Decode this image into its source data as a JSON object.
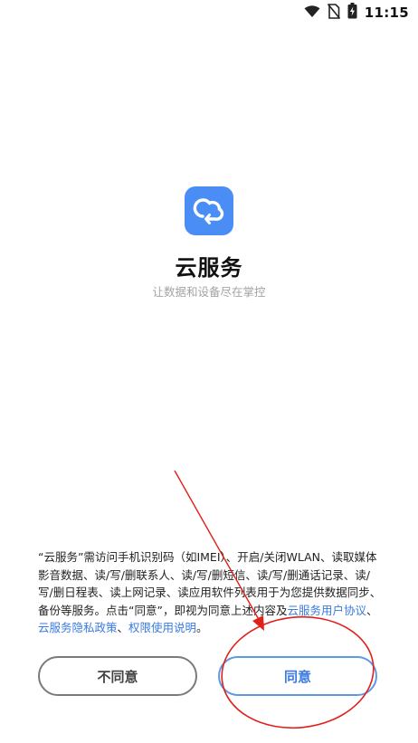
{
  "status_bar": {
    "time": "11:15",
    "icons": [
      "wifi-icon",
      "no-sim-icon",
      "battery-charging-icon"
    ]
  },
  "app": {
    "icon": "cloud-sync-icon",
    "title": "云服务",
    "subtitle": "让数据和设备尽在掌控",
    "accent_color": "#4a8ef5"
  },
  "notice": {
    "text": "“云服务”需访问手机识别码（如IMEI）、开启/关闭WLAN、读取媒体影音数据、读/写/删联系人、读/写/删短信、读/写/删通话记录、读/写/删日程表、读上网记录、读应用软件列表用于为您提供数据同步、备份等服务。点击“同意”，即视为同意上述内容及",
    "link_user_agreement": "云服务用户协议",
    "sep1": "、",
    "link_privacy_policy": "云服务隐私政策",
    "sep2": "、",
    "link_permissions": "权限使用说明",
    "end": "。",
    "link_color": "#3a7be0"
  },
  "buttons": {
    "disagree_label": "不同意",
    "agree_label": "同意"
  },
  "annotation": {
    "color": "#e0201b"
  }
}
